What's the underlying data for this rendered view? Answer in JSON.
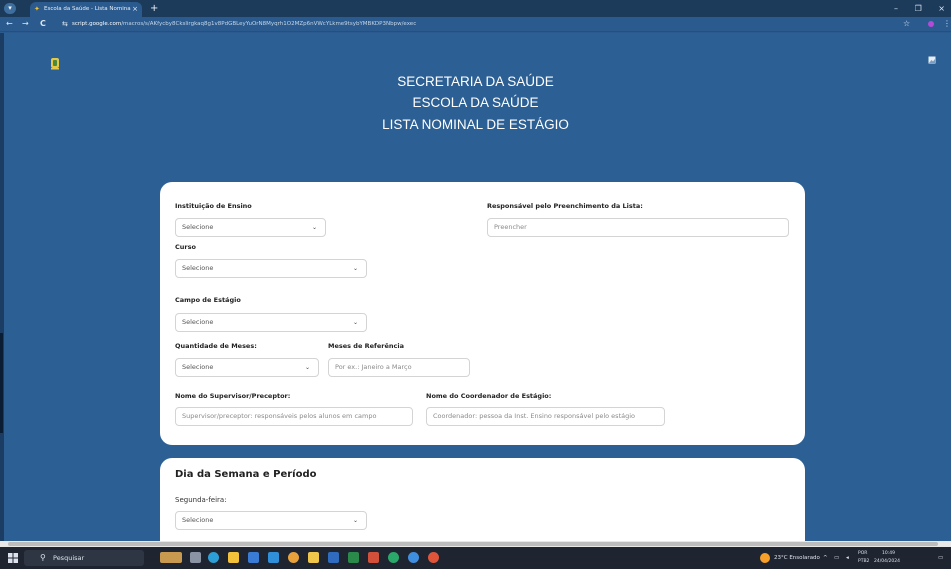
{
  "browser": {
    "tab_title": "Escola da Saúde - Lista Nomina",
    "tab_close": "×",
    "new_tab": "+",
    "url_domain": "script.google.com",
    "url_path": "/macros/s/AKfycby8Ckslirgkaq8g1v8PdGBLeyYuOrN8Myqrh1O2MZp6nVWcYLkme9tsybYMBKDP3Nbpw/exec",
    "star": "☆",
    "menu": "⋮",
    "back": "←",
    "forward": "→",
    "reload": "C"
  },
  "window_controls": {
    "minimize": "–",
    "maximize": "❐",
    "close": "×"
  },
  "header": {
    "line1": "SECRETARIA DA SAÚDE",
    "line2": "ESCOLA DA SAÚDE",
    "line3": "LISTA NOMINAL DE ESTÁGIO"
  },
  "form": {
    "instituicao_label": "Instituição de Ensino",
    "instituicao_value": "Selecione",
    "responsavel_label": "Responsável pelo Preenchimento da Lista:",
    "responsavel_placeholder": "Preencher",
    "curso_label": "Curso",
    "curso_value": "Selecione",
    "campo_label": "Campo de Estágio",
    "campo_value": "Selecione",
    "quantidade_label": "Quantidade de Meses:",
    "quantidade_value": "Selecione",
    "meses_label": "Meses de Referência",
    "meses_placeholder": "Por ex.: Janeiro a Março",
    "supervisor_label": "Nome do Supervisor/Preceptor:",
    "supervisor_placeholder": "Supervisor/preceptor: responsáveis pelos alunos em campo",
    "coordenador_label": "Nome do Coordenador de Estágio:",
    "coordenador_placeholder": "Coordenador: pessoa da Inst. Ensino responsável pelo estágio"
  },
  "schedule": {
    "title": "Dia da Semana e Período",
    "segunda_label": "Segunda-feira:",
    "segunda_value": "Selecione"
  },
  "taskbar": {
    "search_text": "Pesquisar",
    "weather": "23°C Ensolarado",
    "lang_top": "POR",
    "lang_bottom": "PTB2",
    "time": "10:49",
    "date": "24/04/2024",
    "tray_chevron": "^"
  },
  "colors": {
    "page_bg": "#2c5f93",
    "card_bg": "#ffffff",
    "chrome_dark": "#1c3a5a",
    "taskbar_bg": "#1e2430"
  }
}
